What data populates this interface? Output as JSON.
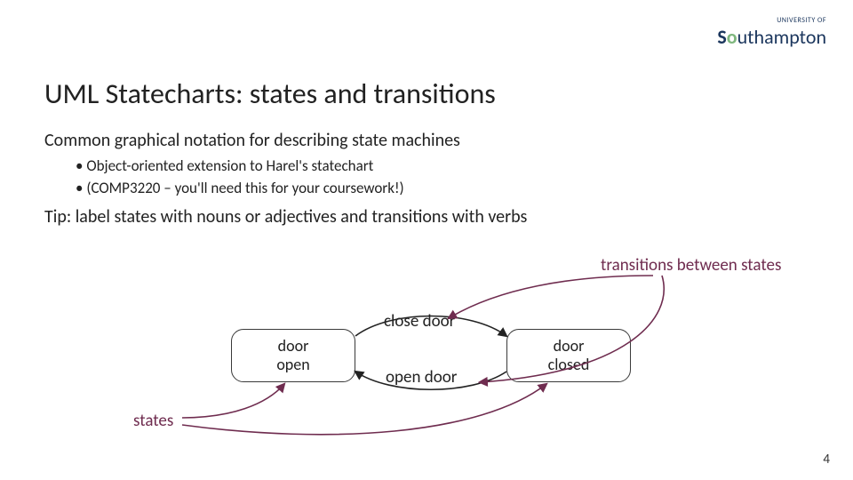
{
  "logo": {
    "overline": "UNIVERSITY OF",
    "name_part1": "S",
    "name_accent": "o",
    "name_part2": "uthampton"
  },
  "title": "UML Statecharts: states and transitions",
  "body_line1": "Common graphical notation for describing state machines",
  "bullets": [
    "Object-oriented extension to Harel's statechart",
    "(COMP3220 – you'll need this for your coursework!)"
  ],
  "body_line2": "Tip: label states with nouns or adjectives and transitions with verbs",
  "diagram": {
    "state_left": "door\nopen",
    "state_right": "door\nclosed",
    "transition_top": "close door",
    "transition_bottom": "open door",
    "callout_transitions": "transitions between states",
    "callout_states": "states"
  },
  "page_number": "4",
  "colors": {
    "accent": "#6f2c4f",
    "logo_navy": "#1b365d",
    "logo_green": "#7fb77e"
  }
}
